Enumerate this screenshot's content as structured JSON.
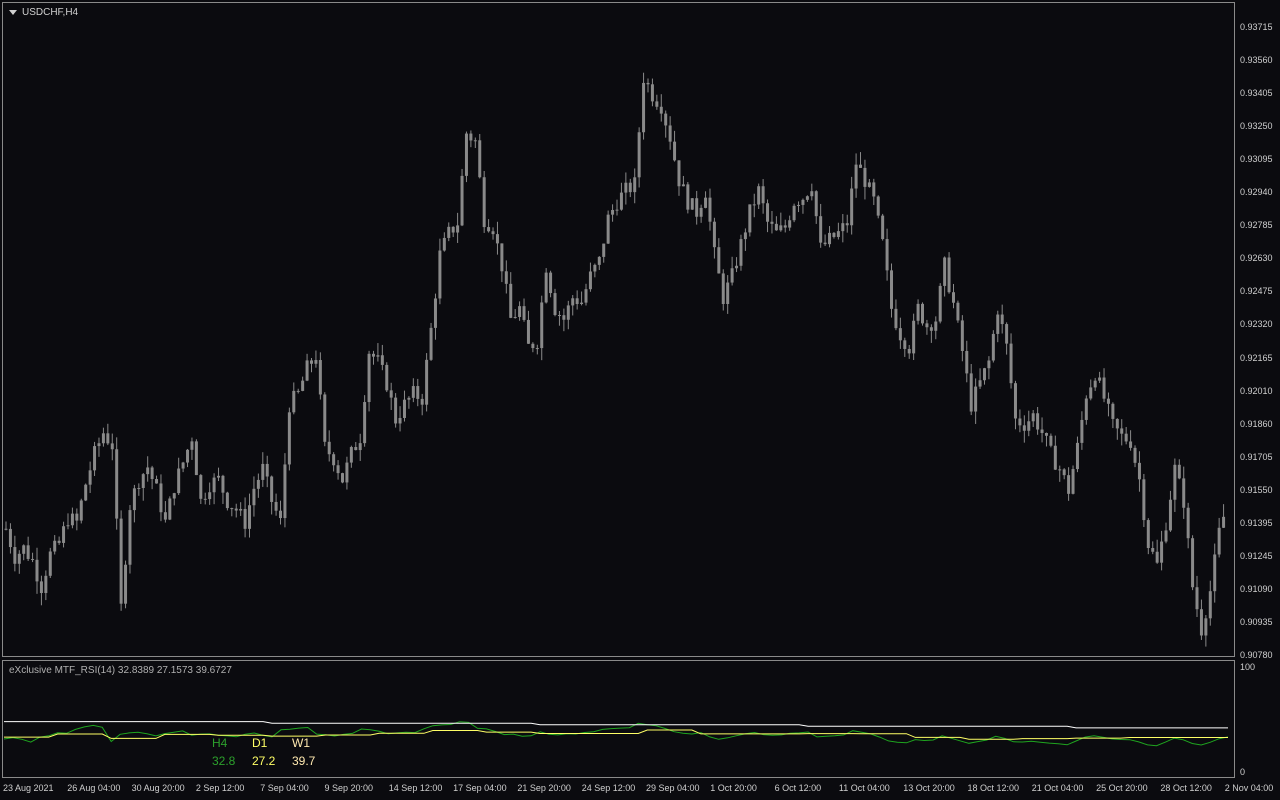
{
  "chart": {
    "symbol_title": "USDCHF,H4",
    "price_labels": [
      "0.93715",
      "0.93560",
      "0.93405",
      "0.93250",
      "0.93095",
      "0.92940",
      "0.92785",
      "0.92630",
      "0.92475",
      "0.92320",
      "0.92165",
      "0.92010",
      "0.91860",
      "0.91705",
      "0.91550",
      "0.91395",
      "0.91245",
      "0.91090",
      "0.90935",
      "0.90780"
    ],
    "candle_color": "#8a8a8a",
    "background": "#0b0b0f",
    "close_series": [
      0.9137,
      0.9124,
      0.9128,
      0.9122,
      0.911,
      0.9125,
      0.913,
      0.9142,
      0.914,
      0.9158,
      0.9172,
      0.9182,
      0.9176,
      0.91,
      0.9148,
      0.916,
      0.9166,
      0.9155,
      0.914,
      0.9157,
      0.9168,
      0.918,
      0.915,
      0.9158,
      0.916,
      0.915,
      0.9146,
      0.914,
      0.9156,
      0.9165,
      0.915,
      0.914,
      0.9195,
      0.92,
      0.9212,
      0.9218,
      0.9175,
      0.917,
      0.916,
      0.9172,
      0.918,
      0.922,
      0.9215,
      0.9205,
      0.9188,
      0.9195,
      0.92,
      0.9198,
      0.923,
      0.9265,
      0.9275,
      0.928,
      0.9322,
      0.9318,
      0.9282,
      0.9278,
      0.926,
      0.9235,
      0.924,
      0.9222,
      0.9225,
      0.926,
      0.924,
      0.9235,
      0.9245,
      0.9243,
      0.9255,
      0.9262,
      0.9282,
      0.929,
      0.9295,
      0.9298,
      0.9348,
      0.934,
      0.9335,
      0.932,
      0.93,
      0.929,
      0.9285,
      0.9295,
      0.9265,
      0.9245,
      0.9255,
      0.927,
      0.9285,
      0.9295,
      0.928,
      0.9275,
      0.9278,
      0.929,
      0.9292,
      0.9298,
      0.9268,
      0.9272,
      0.9275,
      0.928,
      0.9308,
      0.93,
      0.929,
      0.927,
      0.924,
      0.9228,
      0.9222,
      0.924,
      0.9232,
      0.9235,
      0.926,
      0.9242,
      0.922,
      0.9195,
      0.9205,
      0.9215,
      0.924,
      0.9222,
      0.9188,
      0.9186,
      0.919,
      0.9182,
      0.9172,
      0.9165,
      0.9155,
      0.9175,
      0.92,
      0.921,
      0.9198,
      0.9185,
      0.918,
      0.9178,
      0.916,
      0.913,
      0.912,
      0.914,
      0.9165,
      0.915,
      0.911,
      0.909,
      0.9108,
      0.9135,
      0.915
    ]
  },
  "indicator": {
    "title": "eXclusive MTF_RSI(14) 32.8389 27.1573 39.6727",
    "axis_max": "100",
    "axis_min": "0",
    "h4_color": "#1fa51f",
    "d1_color": "#ffff66",
    "w1_color": "#ffffff",
    "headers": {
      "h4": "H4",
      "d1": "D1",
      "w1": "W1"
    },
    "values": {
      "h4": "32.8",
      "d1": "27.2",
      "w1": "39.7"
    },
    "h4_color_text": "#2ca02c",
    "d1_color_text": "#ffff66",
    "w1_color_text": "#ffe9b0"
  },
  "time_labels": [
    "23 Aug 2021",
    "26 Aug 04:00",
    "30 Aug 20:00",
    "2 Sep 12:00",
    "7 Sep 04:00",
    "9 Sep 20:00",
    "14 Sep 12:00",
    "17 Sep 04:00",
    "21 Sep 20:00",
    "24 Sep 12:00",
    "29 Sep 04:00",
    "1 Oct 20:00",
    "6 Oct 12:00",
    "11 Oct 04:00",
    "13 Oct 20:00",
    "18 Oct 12:00",
    "21 Oct 04:00",
    "25 Oct 20:00",
    "28 Oct 12:00",
    "2 Nov 04:00"
  ]
}
